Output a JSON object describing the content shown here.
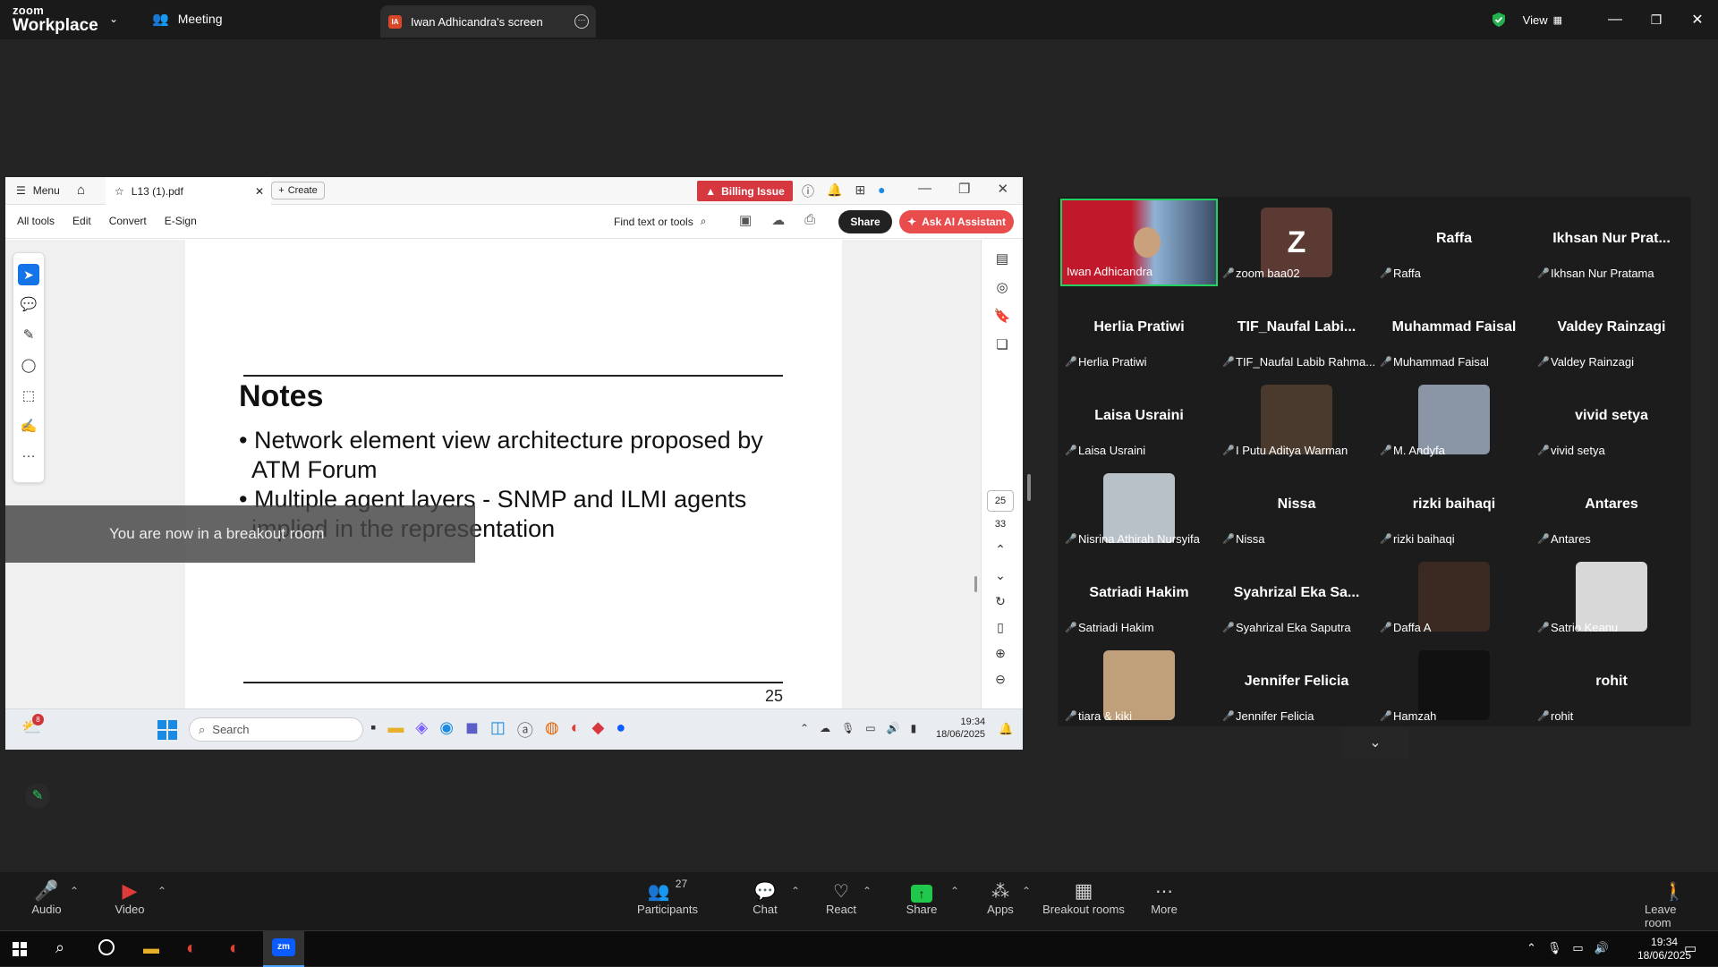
{
  "zoom": {
    "brand_top": "zoom",
    "brand_bottom": "Workplace",
    "meeting_tab": "Meeting",
    "screen_tab_initials": "IA",
    "screen_tab": "Iwan Adhicandra's screen",
    "view_label": "View"
  },
  "acrobat": {
    "menu": "Menu",
    "file_tab": "L13 (1).pdf",
    "create": "Create",
    "billing": "Billing Issue",
    "tools": [
      "All tools",
      "Edit",
      "Convert",
      "E-Sign"
    ],
    "find": "Find text or tools",
    "share": "Share",
    "ai": "Ask AI Assistant",
    "page_current": "25",
    "page_total": "33"
  },
  "slide": {
    "title": "Notes",
    "bullets": [
      "• Network element view architecture proposed by ATM Forum",
      "• Multiple agent layers - SNMP and ILMI agents implied in the representation"
    ],
    "page_number": "25"
  },
  "banner": "You are now in a breakout room",
  "inner_taskbar": {
    "badge": "8",
    "search": "Search",
    "time": "19:34",
    "date": "18/06/2025"
  },
  "participants": [
    {
      "label": "Iwan Adhicandra",
      "big": "",
      "kind": "video"
    },
    {
      "label": "zoom baa02",
      "big": "Z",
      "kind": "avatar"
    },
    {
      "label": "Raffa",
      "big": "Raffa",
      "kind": "text"
    },
    {
      "label": "Ikhsan Nur Pratama",
      "big": "Ikhsan Nur Prat...",
      "kind": "text"
    },
    {
      "label": "Herlia Pratiwi",
      "big": "Herlia Pratiwi",
      "kind": "text"
    },
    {
      "label": "TIF_Naufal Labib Rahma...",
      "big": "TIF_Naufal Labi...",
      "kind": "text"
    },
    {
      "label": "Muhammad Faisal",
      "big": "Muhammad Faisal",
      "kind": "text"
    },
    {
      "label": "Valdey Rainzagi",
      "big": "Valdey Rainzagi",
      "kind": "text"
    },
    {
      "label": "Laisa Usraini",
      "big": "Laisa Usraini",
      "kind": "text"
    },
    {
      "label": "I Putu Aditya Warman",
      "big": "",
      "kind": "photo"
    },
    {
      "label": "M. Andyfa",
      "big": "",
      "kind": "photo"
    },
    {
      "label": "vivid setya",
      "big": "vivid setya",
      "kind": "text"
    },
    {
      "label": "Nisrina Athirah Nursyifa",
      "big": "",
      "kind": "photo"
    },
    {
      "label": "Nissa",
      "big": "Nissa",
      "kind": "text"
    },
    {
      "label": "rizki baihaqi",
      "big": "rizki baihaqi",
      "kind": "text"
    },
    {
      "label": "Antares",
      "big": "Antares",
      "kind": "text"
    },
    {
      "label": "Satriadi Hakim",
      "big": "Satriadi Hakim",
      "kind": "text"
    },
    {
      "label": "Syahrizal Eka Saputra",
      "big": "Syahrizal Eka Sa...",
      "kind": "text"
    },
    {
      "label": "Daffa A",
      "big": "",
      "kind": "photo"
    },
    {
      "label": "Satrio Keanu",
      "big": "",
      "kind": "photo"
    },
    {
      "label": "tiara & kiki",
      "big": "",
      "kind": "photo"
    },
    {
      "label": "Jennifer Felicia",
      "big": "Jennifer Felicia",
      "kind": "text"
    },
    {
      "label": "Hamzah",
      "big": "",
      "kind": "photo"
    },
    {
      "label": "rohit",
      "big": "rohit",
      "kind": "text"
    }
  ],
  "toolbar": {
    "audio": "Audio",
    "video": "Video",
    "participants": "Participants",
    "participants_count": "27",
    "chat": "Chat",
    "react": "React",
    "share": "Share",
    "apps": "Apps",
    "breakout": "Breakout rooms",
    "more": "More",
    "leave": "Leave room"
  },
  "system": {
    "time": "19:34",
    "date": "18/06/2025"
  },
  "colors": {
    "share_green": "#1fc84a",
    "billing_red": "#d7373f",
    "active_speaker": "#23d160"
  }
}
